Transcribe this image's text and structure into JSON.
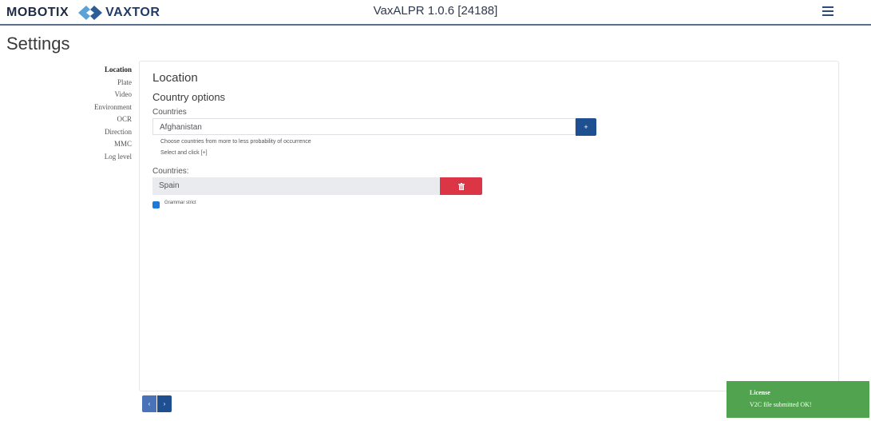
{
  "header": {
    "brand_left": "MOBOTIX",
    "brand_right": "VAXTOR",
    "title": "VaxALPR 1.0.6 [24188]"
  },
  "page": {
    "title": "Settings"
  },
  "sidebar": {
    "items": [
      "Location",
      "Plate",
      "Video",
      "Environment",
      "OCR",
      "Direction",
      "MMC",
      "Log level"
    ],
    "active": "Location"
  },
  "location": {
    "section_title": "Location",
    "subsection_title": "Country options",
    "countries_label": "Countries",
    "selected_country": "Afghanistan",
    "add_label": "+",
    "help_line1": "Choose countries from more to less probability of occurrence",
    "help_line2": "Select and click [+]",
    "list_label": "Countries:",
    "list": [
      "Spain"
    ],
    "grammar_label": "Grammar strict",
    "grammar_checked": true
  },
  "pager": {
    "prev": "‹",
    "next": "›"
  },
  "toast": {
    "title": "License",
    "message": "V2C file submitted OK!"
  },
  "colors": {
    "primary": "#1d4f91",
    "danger": "#dc3545",
    "success": "#52a350",
    "checkbox": "#1e7ad8"
  }
}
